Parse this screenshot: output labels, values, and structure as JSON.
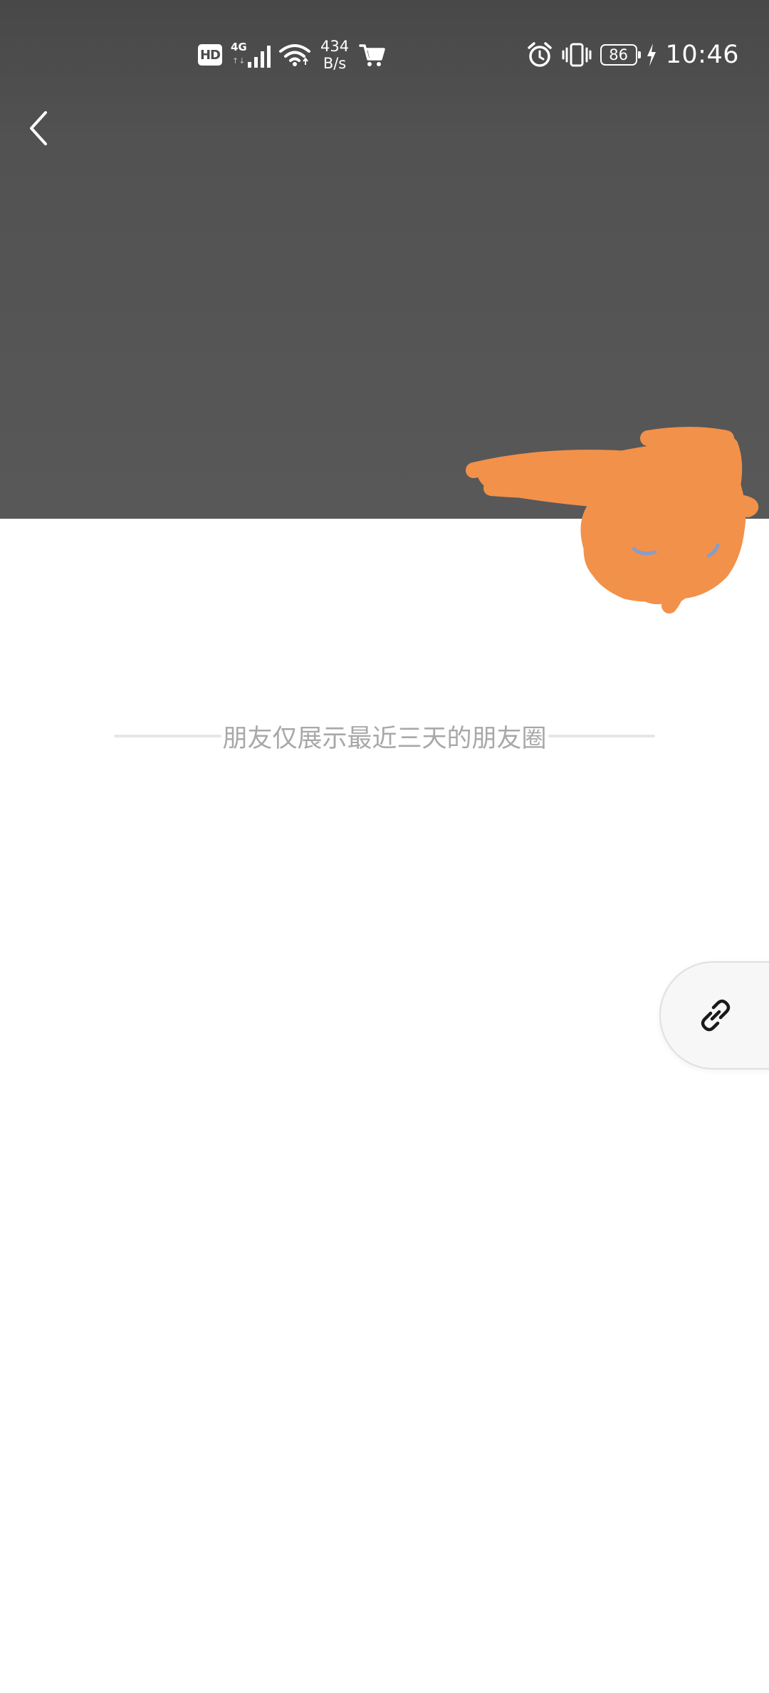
{
  "status_bar": {
    "hd": "HD",
    "network": "4G",
    "network_arrows": "↑↓",
    "speed_value": "434",
    "speed_unit": "B/s",
    "battery": "86",
    "time": "10:46"
  },
  "feed": {
    "notice": "朋友仅展示最近三天的朋友圈"
  },
  "colors": {
    "cover": "#555555",
    "redaction": "#F2914A",
    "notice_text": "#A8A8A8"
  },
  "icons": {
    "back": "chevron-left-icon",
    "link": "link-icon"
  }
}
